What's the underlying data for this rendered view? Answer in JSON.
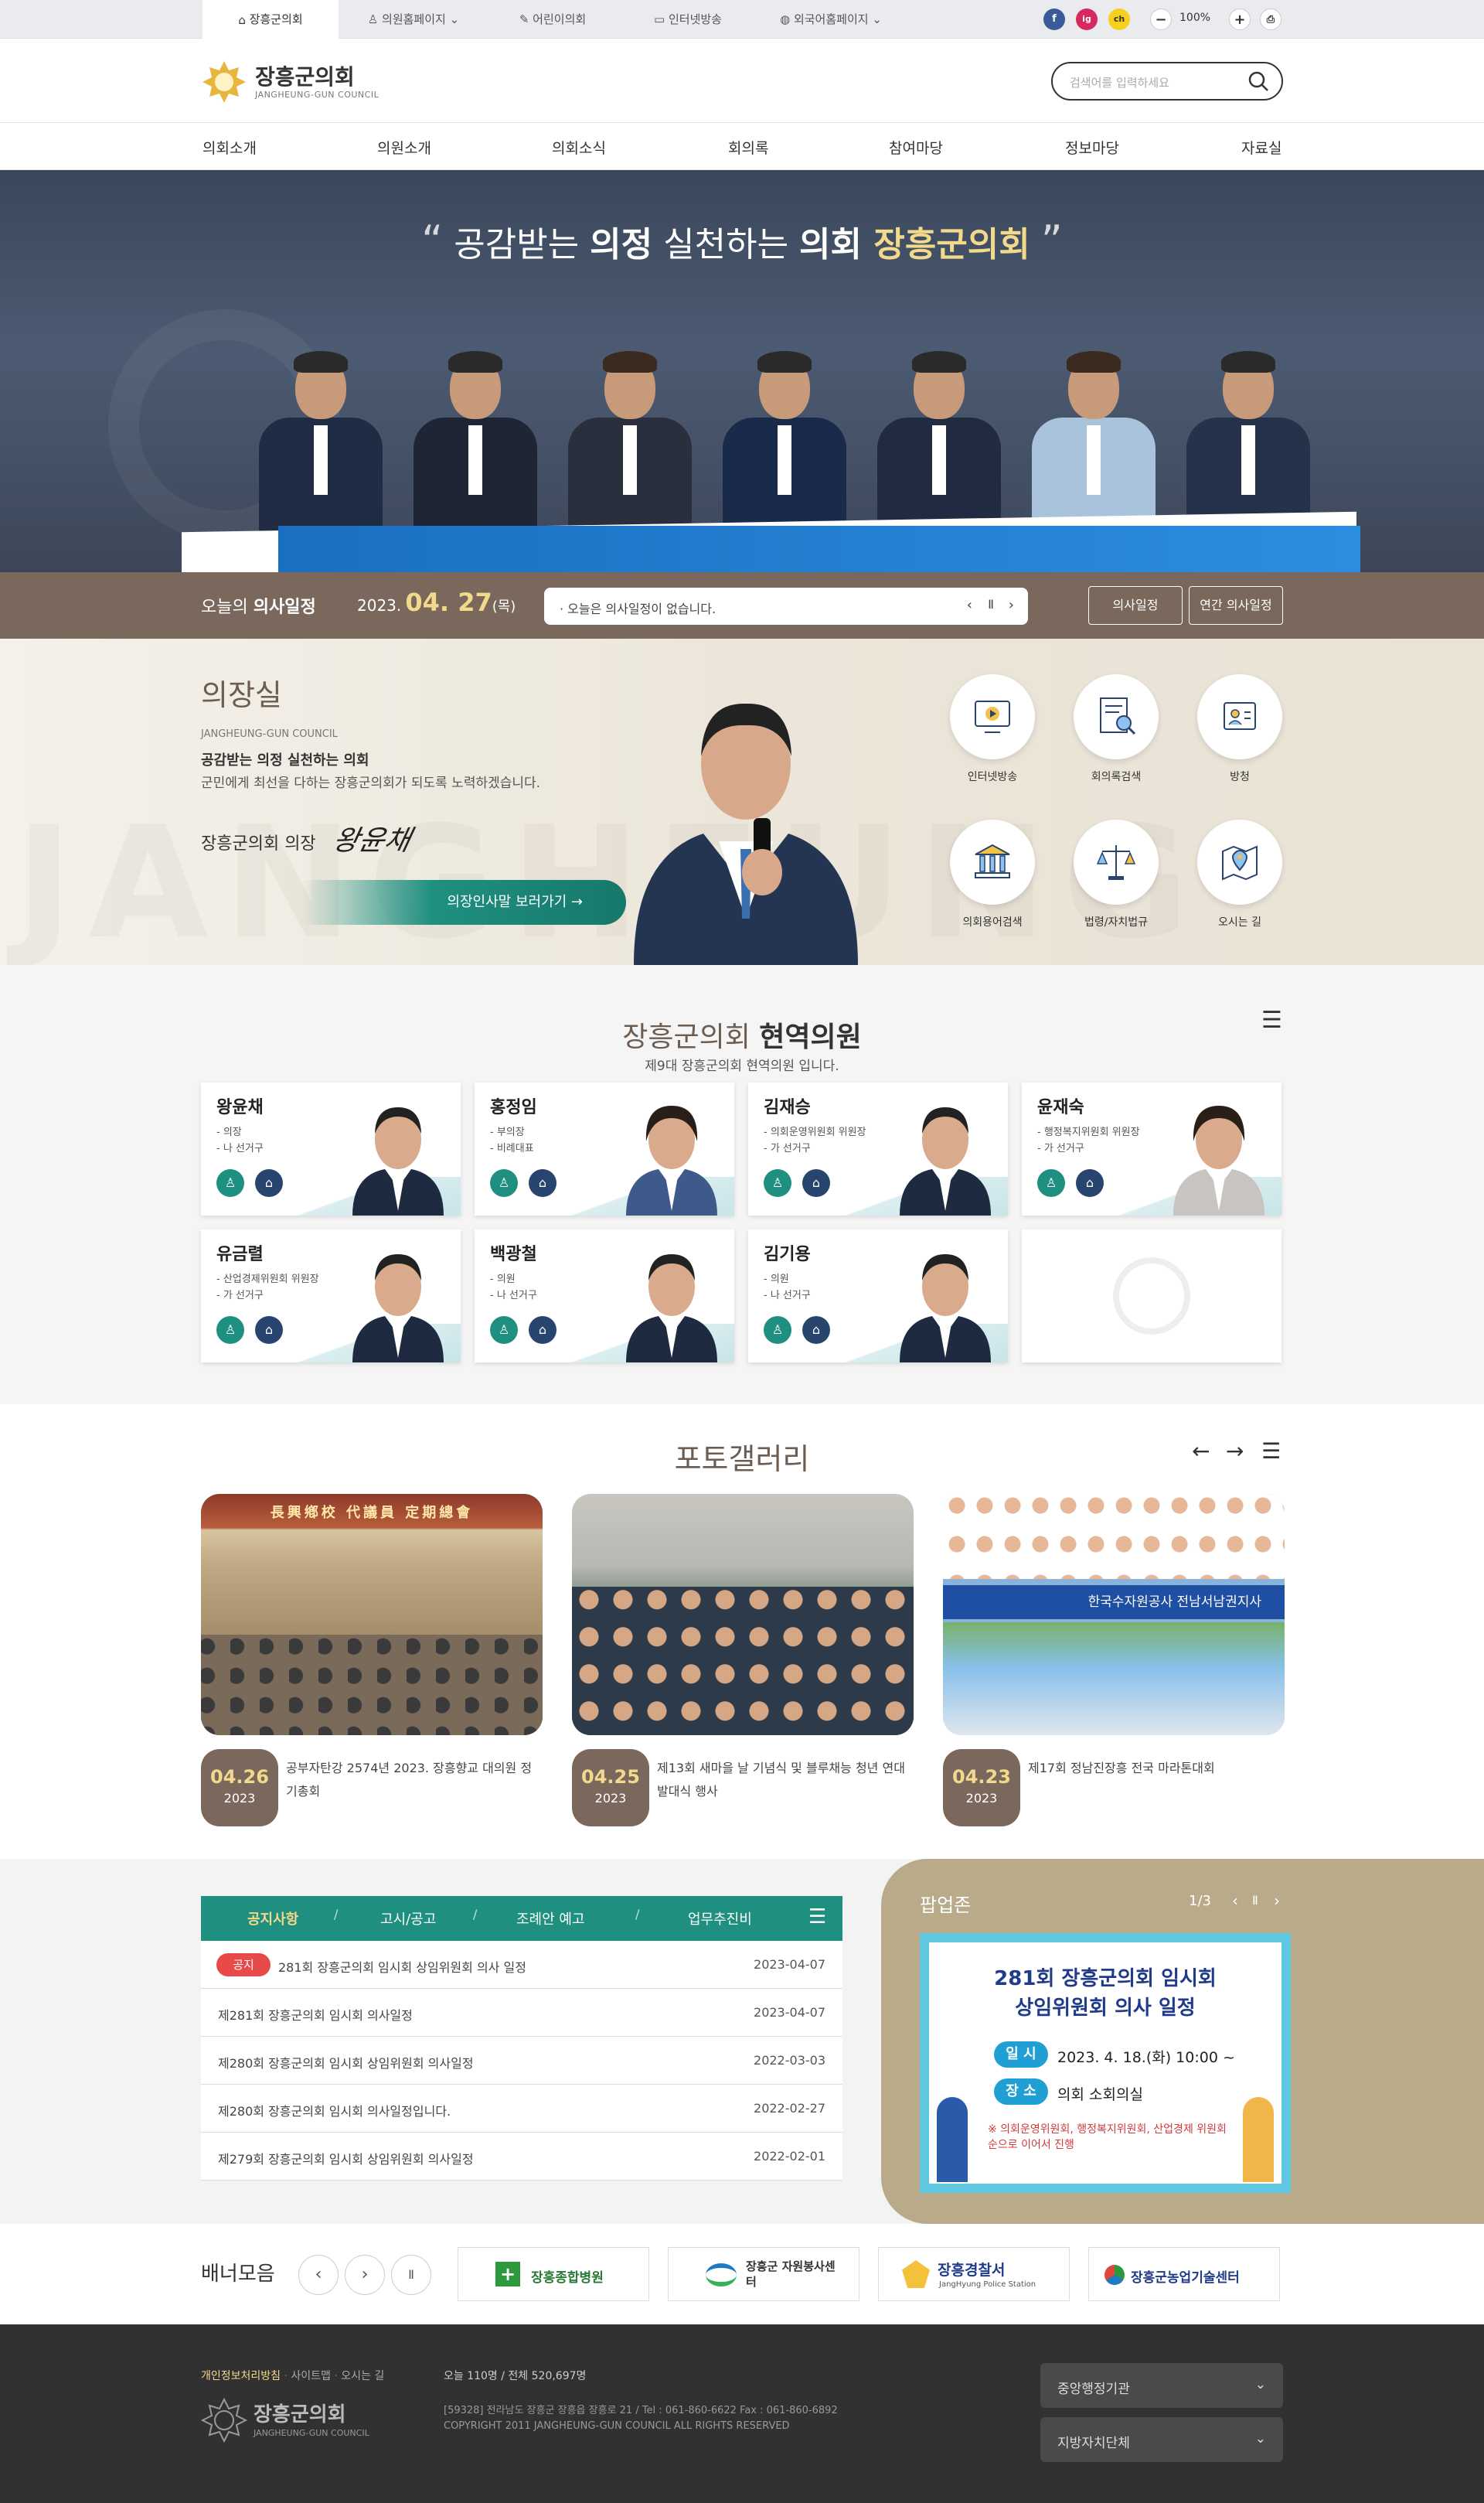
{
  "util": {
    "tabs": [
      "장흥군의회",
      "의원홈페이지",
      "어린이의회",
      "인터넷방송",
      "외국어홈페이지"
    ],
    "social": [
      "f",
      "ig",
      "ch"
    ],
    "zoom": "100%",
    "zoom_minus": "−",
    "zoom_plus": "+"
  },
  "header": {
    "name": "장흥군의회",
    "ename": "JANGHEUNG-GUN COUNCIL",
    "search_placeholder": "검색어를 입력하세요"
  },
  "nav": [
    "의회소개",
    "의원소개",
    "의회소식",
    "회의록",
    "참여마당",
    "정보마당",
    "자료실"
  ],
  "hero": {
    "slogan_a": "공감받는 ",
    "slogan_b": "의정",
    "slogan_c": " 실천하는 ",
    "slogan_d": "의회",
    "slogan_e": " 장흥군의회"
  },
  "schedule": {
    "label_a": "오늘의 ",
    "label_b": "의사일정",
    "year": "2023.",
    "date": "04. 27",
    "dow": "(목)",
    "message": "· 오늘은 의사일정이 없습니다.",
    "btn1": "의사일정",
    "btn2": "연간 의사일정"
  },
  "chair": {
    "title": "의장실",
    "ename": "JANGHEUNG-GUN COUNCIL",
    "line1": "공감받는 의정 실천하는 의회",
    "line2": "군민에게 최선을 다하는 장흥군의회가 되도록 노력하겠습니다.",
    "sign_label": "장흥군의회 의장",
    "signature": "왕윤채",
    "greeting_btn": "의장인사말 보러가기 →",
    "bg_text": "JANGHEUNG"
  },
  "quick": [
    {
      "label": "인터넷방송",
      "icon": "broadcast-icon"
    },
    {
      "label": "회의록검색",
      "icon": "minutes-search-icon"
    },
    {
      "label": "방청",
      "icon": "attendance-icon"
    },
    {
      "label": "의회용어검색",
      "icon": "council-building-icon"
    },
    {
      "label": "법령/자치법규",
      "icon": "law-scale-icon"
    },
    {
      "label": "오시는 길",
      "icon": "map-pin-icon"
    }
  ],
  "members": {
    "title_a": "장흥군의회 ",
    "title_b": "현역의원",
    "subtitle": "제9대 장흥군의회 현역의원 입니다.",
    "list": [
      {
        "name": "왕윤채",
        "role1": "- 의장",
        "role2": "- 나 선거구"
      },
      {
        "name": "홍정임",
        "role1": "- 부의장",
        "role2": "- 비례대표"
      },
      {
        "name": "김재승",
        "role1": "- 의회운영위원회 위원장",
        "role2": "- 가 선거구"
      },
      {
        "name": "윤재숙",
        "role1": "- 행정복지위원회 위원장",
        "role2": "- 가 선거구"
      },
      {
        "name": "유금렬",
        "role1": "- 산업경제위원회 위원장",
        "role2": "- 가 선거구"
      },
      {
        "name": "백광철",
        "role1": "- 의원",
        "role2": "- 나 선거구"
      },
      {
        "name": "김기용",
        "role1": "- 의원",
        "role2": "- 나 선거구"
      }
    ]
  },
  "gallery": {
    "title": "포토갤러리",
    "items": [
      {
        "md": "04.26",
        "year": "2023",
        "title": "공부자탄강 2574년 2023. 장흥향교 대의원 정기총회",
        "banner": "長興鄕校 代議員 定期總會"
      },
      {
        "md": "04.25",
        "year": "2023",
        "title": "제13회 새마을 날 기념식 및 블루채능 청년 연대 발대식 행사",
        "banner": ""
      },
      {
        "md": "04.23",
        "year": "2023",
        "title": "제17회 정남진장흥 전국 마라톤대회",
        "banner": "한국수자원공사 전남서남권지사"
      }
    ]
  },
  "notice": {
    "tabs": [
      "공지사항",
      "고시/공고",
      "조례안 예고",
      "업무추진비"
    ],
    "badge": "공지",
    "rows": [
      {
        "title": "281회 장흥군의회 임시회 상임위원회 의사 일정",
        "date": "2023-04-07"
      },
      {
        "title": "제281회 장흥군의회 임시회 의사일정",
        "date": "2023-04-07"
      },
      {
        "title": "제280회 장흥군의회 임시회 상임위원회 의사일정",
        "date": "2022-03-03"
      },
      {
        "title": "제280회 장흥군의회 임시회 의사일정입니다.",
        "date": "2022-02-27"
      },
      {
        "title": "제279회 장흥군의회 임시회 상임위원회 의사일정",
        "date": "2022-02-01"
      }
    ]
  },
  "popup": {
    "title": "팝업존",
    "page": "1/3",
    "card_title1": "281회 장흥군의회 임시회",
    "card_title2": "상임위원회 의사 일정",
    "row1_label": "일 시",
    "row1_value": "2023. 4. 18.(화) 10:00 ~",
    "row2_label": "장 소",
    "row2_value": "의회 소회의실",
    "note": "※ 의회운영위원회, 행정복지위원회, 산업경제 위원회 순으로 이어서 진행"
  },
  "banners": {
    "title": "배너모음",
    "items": [
      "장흥종합병원",
      "장흥군 자원봉사센터",
      "장흥경찰서",
      "장흥군농업기술센터"
    ],
    "police_sub": "JangHyung Police Station"
  },
  "footer": {
    "links": [
      "개인정보처리방침",
      "사이트맵",
      "오시는 길"
    ],
    "visits": "오늘 110명 / 전체 520,697명",
    "name": "장흥군의회",
    "ename": "JANGHEUNG-GUN COUNCIL",
    "addr": "[59328] 전라남도 장흥군 장흥읍 장흥로 21 / Tel : 061-860-6622 Fax : 061-860-6892",
    "copy": "COPYRIGHT  2011 JANGHEUNG-GUN COUNCIL ALL RIGHTS RESERVED",
    "sel1": "중앙행정기관",
    "sel2": "지방자치단체"
  },
  "colors": {
    "brown": "#7a685c",
    "teal": "#1f9080",
    "navy": "#27456e",
    "gold": "#f3d98b"
  }
}
